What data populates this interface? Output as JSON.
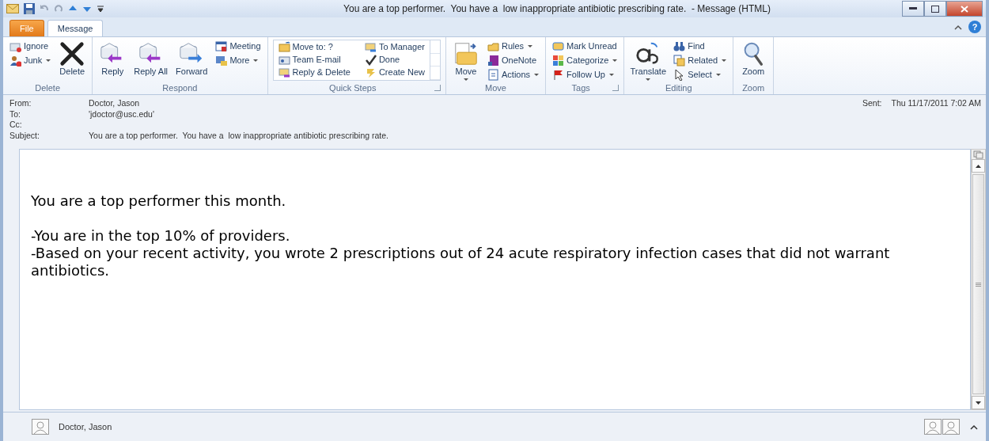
{
  "window": {
    "title": "You are a top performer.  You have a  low inappropriate antibiotic prescribing rate.  - Message (HTML)"
  },
  "tabs": [
    {
      "label": "File",
      "kind": "file",
      "selected": false
    },
    {
      "label": "Message",
      "kind": "tab",
      "selected": true
    }
  ],
  "help_button": "?",
  "ribbon": {
    "groups": [
      {
        "label": "Delete",
        "launcher": false,
        "columns": [
          {
            "kind": "small",
            "items": [
              {
                "label": "Ignore",
                "dropdown": false
              },
              {
                "label": "Junk",
                "dropdown": true
              }
            ]
          },
          {
            "kind": "large",
            "items": [
              {
                "label": "Delete",
                "dropdown": false
              }
            ]
          }
        ]
      },
      {
        "label": "Respond",
        "launcher": false,
        "columns": [
          {
            "kind": "large",
            "items": [
              {
                "label": "Reply",
                "dropdown": false
              }
            ]
          },
          {
            "kind": "large",
            "items": [
              {
                "label": "Reply All",
                "dropdown": false
              }
            ]
          },
          {
            "kind": "large",
            "items": [
              {
                "label": "Forward",
                "dropdown": false
              }
            ]
          },
          {
            "kind": "small",
            "items": [
              {
                "label": "Meeting",
                "dropdown": false
              },
              {
                "label": "More",
                "dropdown": true
              }
            ]
          }
        ]
      },
      {
        "label": "Quick Steps",
        "launcher": true,
        "columns": [
          {
            "kind": "gallery",
            "items": [
              {
                "label": "Move to: ?",
                "dropdown": false
              },
              {
                "label": "Team E-mail",
                "dropdown": false
              },
              {
                "label": "Reply & Delete",
                "dropdown": false
              },
              {
                "label": "To Manager",
                "dropdown": false
              },
              {
                "label": "Done",
                "dropdown": false
              },
              {
                "label": "Create New",
                "dropdown": false
              }
            ]
          }
        ]
      },
      {
        "label": "Move",
        "launcher": false,
        "columns": [
          {
            "kind": "large",
            "items": [
              {
                "label": "Move",
                "dropdown": true
              }
            ]
          },
          {
            "kind": "small",
            "items": [
              {
                "label": "Rules",
                "dropdown": true
              },
              {
                "label": "OneNote",
                "dropdown": false
              },
              {
                "label": "Actions",
                "dropdown": true
              }
            ]
          }
        ]
      },
      {
        "label": "Tags",
        "launcher": true,
        "columns": [
          {
            "kind": "small",
            "items": [
              {
                "label": "Mark Unread",
                "dropdown": false
              },
              {
                "label": "Categorize",
                "dropdown": true
              },
              {
                "label": "Follow Up",
                "dropdown": true
              }
            ]
          }
        ]
      },
      {
        "label": "Editing",
        "launcher": false,
        "columns": [
          {
            "kind": "large",
            "items": [
              {
                "label": "Translate",
                "dropdown": true
              }
            ]
          },
          {
            "kind": "small",
            "items": [
              {
                "label": "Find",
                "dropdown": false
              },
              {
                "label": "Related",
                "dropdown": true
              },
              {
                "label": "Select",
                "dropdown": true
              }
            ]
          }
        ]
      },
      {
        "label": "Zoom",
        "launcher": false,
        "columns": [
          {
            "kind": "large",
            "items": [
              {
                "label": "Zoom",
                "dropdown": false
              }
            ]
          }
        ]
      }
    ]
  },
  "header": {
    "fields": [
      {
        "label": "From:",
        "value": "Doctor, Jason"
      },
      {
        "label": "To:",
        "value": "'jdoctor@usc.edu'"
      },
      {
        "label": "Cc:"
      },
      {
        "label": "Subject:",
        "value": "You are a top performer.  You have a  low inappropriate antibiotic prescribing rate."
      }
    ],
    "sent": {
      "label": "Sent:",
      "value": "Thu 11/17/2011 7:02 AM"
    }
  },
  "body": {
    "paragraphs": [
      "You are a top performer this month.",
      "-You are in the top 10% of providers.",
      "-Based on your recent activity, you wrote 2 prescriptions out of 24 acute respiratory infection cases that did not warrant antibiotics."
    ]
  },
  "people_pane": {
    "name": "Doctor, Jason"
  }
}
